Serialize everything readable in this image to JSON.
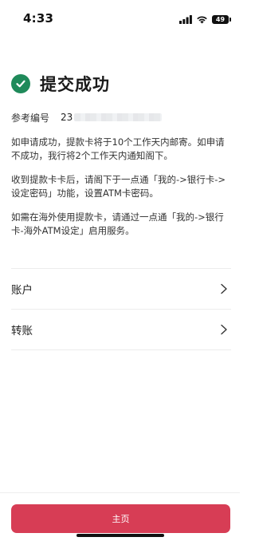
{
  "status_bar": {
    "time": "4:33",
    "battery": "49",
    "icons": [
      "signal-icon",
      "wifi-icon",
      "battery-icon"
    ]
  },
  "header": {
    "icon": "check-circle-icon",
    "title": "提交成功",
    "accent_color": "#1f8a5a"
  },
  "reference": {
    "label": "参考编号",
    "value_visible": "23"
  },
  "notes": [
    "如申请成功，提款卡将于10个工作天内邮寄。如申请不成功，我行将2个工作天内通知阁下。",
    "收到提款卡卡后，请阁下于一点通「我的->银行卡->设定密码」功能，设置ATM卡密码。",
    "如需在海外使用提款卡，请通过一点通「我的->银行卡-海外ATM设定」启用服务。"
  ],
  "menu": [
    {
      "label": "账户",
      "icon": "chevron-right-icon"
    },
    {
      "label": "转账",
      "icon": "chevron-right-icon"
    }
  ],
  "footer": {
    "home_button_label": "主页",
    "button_color": "#d73d55"
  }
}
